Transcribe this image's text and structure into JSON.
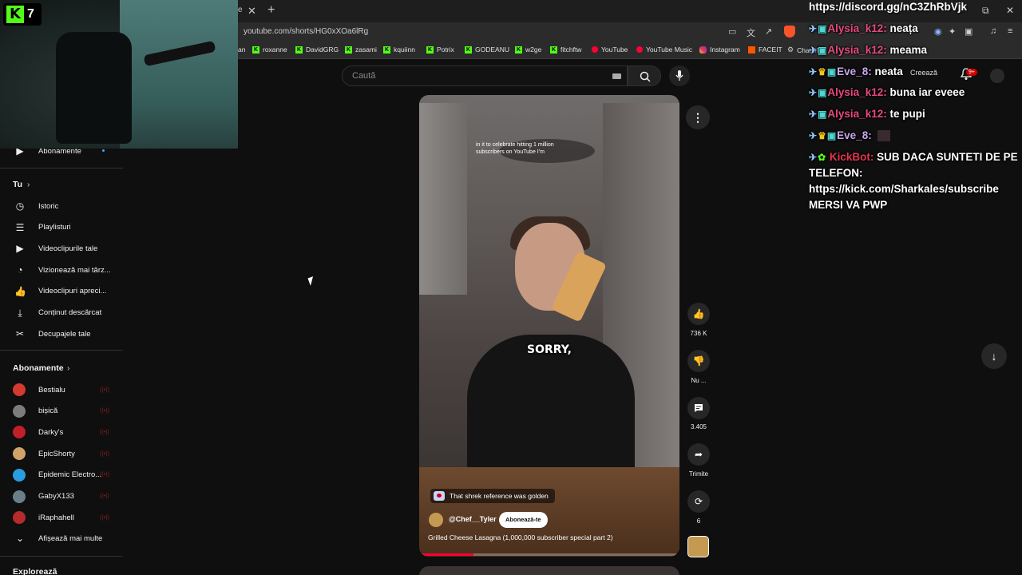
{
  "browser": {
    "tab_partial": "e",
    "url": "youtube.com/shorts/HG0xXOa6lRg",
    "bookmarks": [
      {
        "label": "an",
        "icon": "none"
      },
      {
        "label": "roxanne",
        "icon": "kick"
      },
      {
        "label": "DavidGRG",
        "icon": "kick"
      },
      {
        "label": "zasami",
        "icon": "kick"
      },
      {
        "label": "kquiinn",
        "icon": "kick"
      },
      {
        "label": "Potrix",
        "icon": "kick"
      },
      {
        "label": "GODEANU",
        "icon": "kick"
      },
      {
        "label": "w2ge",
        "icon": "kick"
      },
      {
        "label": "fitchftw",
        "icon": "kick"
      },
      {
        "label": "YouTube",
        "icon": "youtube"
      },
      {
        "label": "YouTube Music",
        "icon": "youtube"
      },
      {
        "label": "Instagram",
        "icon": "instagram"
      },
      {
        "label": "FACEIT",
        "icon": "faceit"
      },
      {
        "label": "ChatGP",
        "icon": "gear"
      }
    ]
  },
  "webcam": {
    "kick_number": "7"
  },
  "header": {
    "search_placeholder": "Caută",
    "create_label": "Creează",
    "notif_count": "9+"
  },
  "sidebar": {
    "top_item": "Abonamente",
    "you_heading": "Tu",
    "you_items": [
      {
        "label": "Istoric",
        "icon": "history-icon"
      },
      {
        "label": "Playlisturi",
        "icon": "playlist-icon"
      },
      {
        "label": "Videoclipurile tale",
        "icon": "video-icon"
      },
      {
        "label": "Vizionează mai târz...",
        "icon": "clock-icon"
      },
      {
        "label": "Videoclipuri apreci...",
        "icon": "like-icon"
      },
      {
        "label": "Conținut descărcat",
        "icon": "download-icon"
      },
      {
        "label": "Decupajele tale",
        "icon": "scissors-icon"
      }
    ],
    "subs_heading": "Abonamente",
    "subs": [
      {
        "label": "Bestialu",
        "color": "#d43a2f"
      },
      {
        "label": "bișică",
        "color": "#7d7d7d"
      },
      {
        "label": "Darky's",
        "color": "#c0202a"
      },
      {
        "label": "EpicShorty",
        "color": "#cfa36a"
      },
      {
        "label": "Epidemic Electro...",
        "color": "#2a9de0"
      },
      {
        "label": "GabyX133",
        "color": "#6b7f8a"
      },
      {
        "label": "iRaphahell",
        "color": "#b52a2a"
      }
    ],
    "show_more": "Afișează mai multe",
    "explore_heading": "Explorează"
  },
  "short": {
    "caption_top": "in it to celebrate hitting 1 million subscribers on YouTube I'm",
    "subtitle": "SORRY,",
    "comment_preview": "That shrek reference was golden",
    "channel": "@Chef__Tyler",
    "subscribe_label": "Abonează-te",
    "title": "Grilled Cheese Lasagna (1,000,000 subscriber special part 2)",
    "progress": 0.21
  },
  "actions": {
    "likes": "736 K",
    "dislike": "Nu ...",
    "comments": "3.405",
    "share": "Trimite",
    "remix": "6"
  },
  "chat": {
    "discord": "https://discord.gg/nC3ZhRbVjk",
    "messages": [
      {
        "user": "Alysia_k12:",
        "text": "neața",
        "user_color": "pink",
        "crown": false
      },
      {
        "user": "Alysia_k12:",
        "text": "meama",
        "user_color": "pink",
        "crown": false
      },
      {
        "user": "Eve_8:",
        "text": "neata",
        "user_color": "purple",
        "crown": true
      },
      {
        "user": "Alysia_k12:",
        "text": "buna iar eveee",
        "user_color": "pink",
        "crown": false
      },
      {
        "user": "Alysia_k12:",
        "text": "te pupi",
        "user_color": "pink",
        "crown": false
      },
      {
        "user": "Eve_8:",
        "text": "",
        "user_color": "purple",
        "crown": true
      }
    ],
    "bot_user": "KickBot:",
    "bot_text": "SUB DACA SUNTETI DE PE TELEFON: https://kick.com/Sharkales/subscribe MERSI VA PWP"
  }
}
